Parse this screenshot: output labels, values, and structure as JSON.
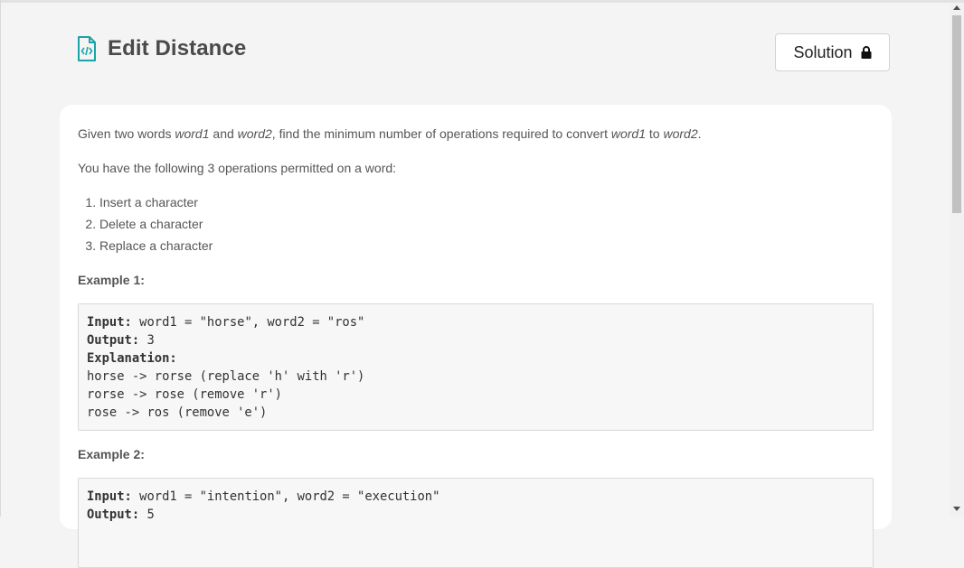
{
  "header": {
    "title": "Edit Distance",
    "icon": "code-file-icon"
  },
  "solution_button": {
    "label": "Solution",
    "icon": "lock-icon"
  },
  "problem": {
    "intro_prefix": "Given two words ",
    "intro_w1": "word1",
    "intro_and": " and ",
    "intro_w2": "word2",
    "intro_mid": ", find the minimum number of operations required to convert ",
    "intro_w1b": "word1",
    "intro_to": " to ",
    "intro_w2b": "word2",
    "intro_end": ".",
    "ops_intro": "You have the following 3 operations permitted on a word:",
    "operations": [
      "Insert a character",
      "Delete a character",
      "Replace a character"
    ]
  },
  "examples": [
    {
      "label": "Example 1:",
      "input_label": "Input:",
      "input_value": " word1 = \"horse\", word2 = \"ros\"",
      "output_label": "Output:",
      "output_value": " 3",
      "explanation_label": "Explanation:",
      "explanation_lines": [
        "horse -> rorse (replace 'h' with 'r')",
        "rorse -> rose (remove 'r')",
        "rose -> ros (remove 'e')"
      ]
    },
    {
      "label": "Example 2:",
      "input_label": "Input:",
      "input_value": " word1 = \"intention\", word2 = \"execution\"",
      "output_label": "Output:",
      "output_value": " 5"
    }
  ],
  "colors": {
    "accent": "#1aa3a8",
    "background": "#f4f4f4",
    "card": "#ffffff"
  }
}
